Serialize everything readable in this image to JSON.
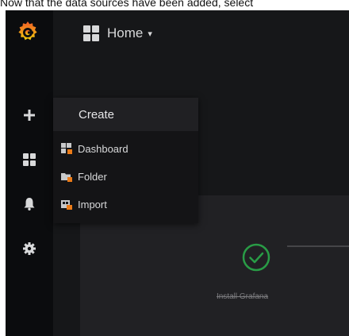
{
  "caption": "Now that the data sources have been added, select",
  "topbar": {
    "title": "Home"
  },
  "create_menu": {
    "header": "Create",
    "items": [
      {
        "label": "Dashboard",
        "icon": "dashboard-icon"
      },
      {
        "label": "Folder",
        "icon": "folder-icon"
      },
      {
        "label": "Import",
        "icon": "import-icon"
      }
    ]
  },
  "getting_started": {
    "step_label": "Install Grafana",
    "step_status": "done"
  },
  "colors": {
    "brand": "#f46800",
    "success": "#299c46"
  }
}
